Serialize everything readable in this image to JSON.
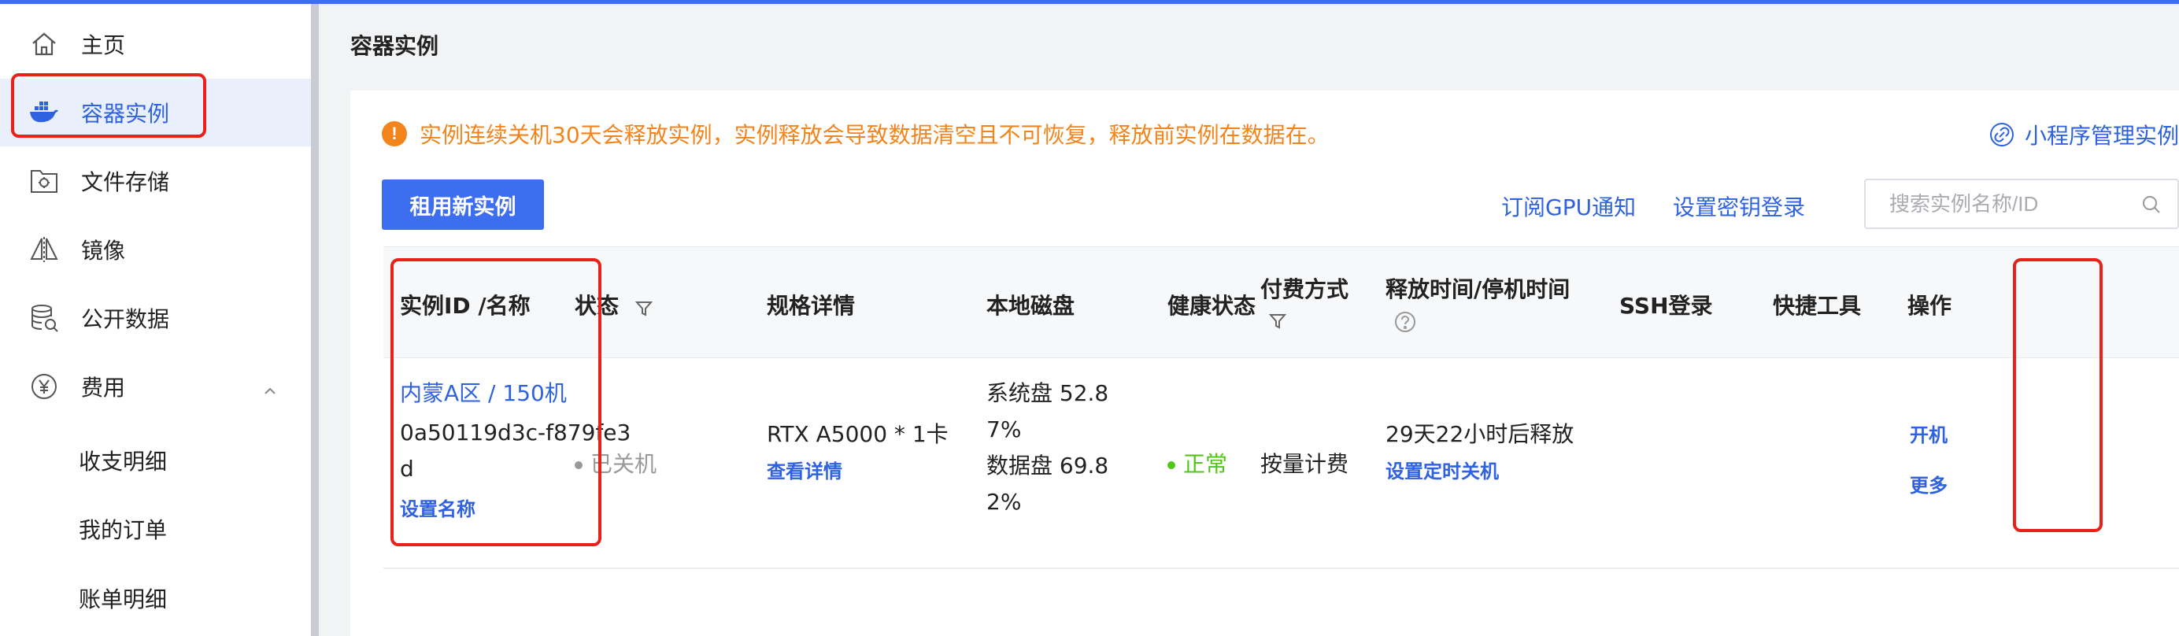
{
  "sidebar": {
    "items": [
      {
        "label": "主页",
        "icon": "home-icon"
      },
      {
        "label": "容器实例",
        "icon": "docker-whale-icon",
        "active": true
      },
      {
        "label": "文件存储",
        "icon": "storage-box-icon"
      },
      {
        "label": "镜像",
        "icon": "image-mirror-icon"
      },
      {
        "label": "公开数据",
        "icon": "database-icon"
      },
      {
        "label": "费用",
        "icon": "yuan-icon",
        "expanded": true
      },
      {
        "label": "收支明细"
      },
      {
        "label": "我的订单"
      },
      {
        "label": "账单明细"
      }
    ]
  },
  "header": {
    "title": "容器实例"
  },
  "notice": {
    "text": "实例连续关机30天会释放实例，实例释放会导致数据清空且不可恢复，释放前实例在数据在。",
    "mini_program_link": "小程序管理实例"
  },
  "toolbar": {
    "rent_button": "租用新实例",
    "gpu_notify_link": "订阅GPU通知",
    "ssh_key_link": "设置密钥登录",
    "search_placeholder": "搜索实例名称/ID"
  },
  "table": {
    "columns": [
      "实例ID /名称",
      "状态",
      "规格详情",
      "本地磁盘",
      "健康状态",
      "付费方式",
      "释放时间/停机时间",
      "SSH登录",
      "快捷工具",
      "操作"
    ],
    "rows": [
      {
        "region": "内蒙A区 / 150机",
        "id_line1": "0a50119d3c-f879fe3",
        "id_line2": "d",
        "set_name": "设置名称",
        "status": "已关机",
        "spec": "RTX A5000 * 1卡",
        "spec_link": "查看详情",
        "disk_sys_1": "系统盘 52.8",
        "disk_sys_2": "7%",
        "disk_data_1": "数据盘 69.8",
        "disk_data_2": "2%",
        "health": "正常",
        "billing": "按量计费",
        "release": "29天22小时后释放",
        "release_link": "设置定时关机",
        "ssh": "",
        "tools": "",
        "action_start": "开机",
        "action_more": "更多"
      }
    ]
  },
  "colors": {
    "accent": "#3d6ef0",
    "link": "#2f62e0",
    "warning": "#f3841b",
    "healthy": "#52c41a",
    "highlight_box": "#e8221b"
  }
}
